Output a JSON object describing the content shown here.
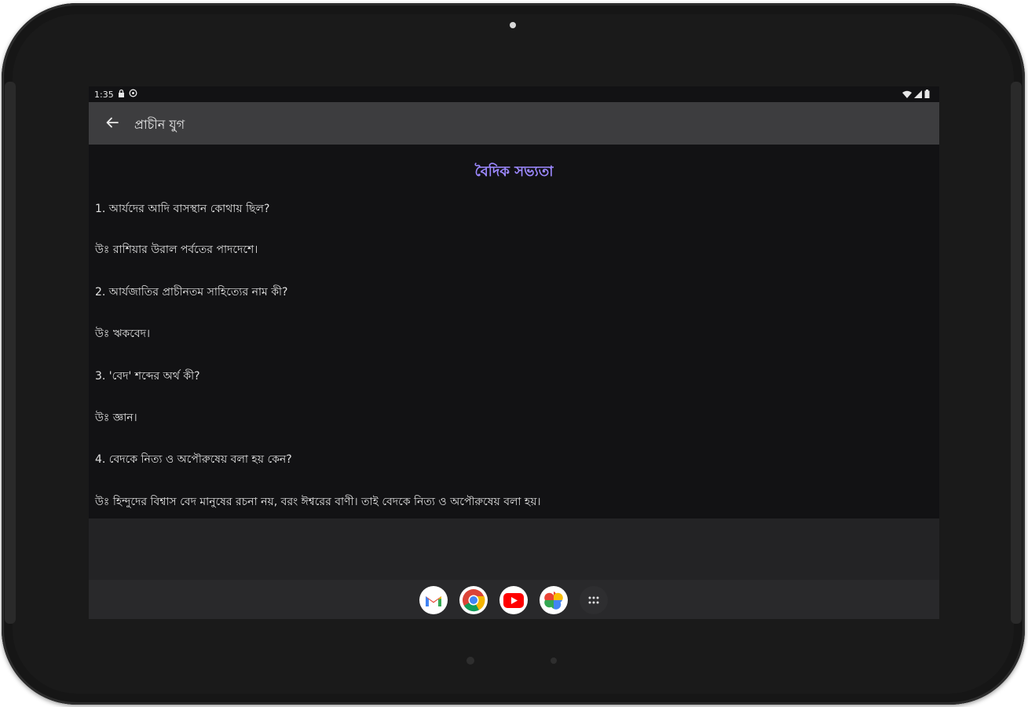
{
  "status_bar": {
    "time": "1:35"
  },
  "app_bar": {
    "title": "প্রাচীন যুগ",
    "back_icon": "arrow-left-icon"
  },
  "content": {
    "section_title": "বৈদিক সভ্যতা",
    "lines": [
      "1. আর্যদের আদি বাসস্থান কোথায় ছিল?",
      "উঃ রাশিয়ার উরাল পর্বতের পাদদেশে।",
      "2. আর্যজাতির প্রাচীনতম সাহিত্যের নাম কী?",
      "উঃ ঋকবেদ।",
      "3. 'বেদ' শব্দের অর্থ কী?",
      "উঃ জ্ঞান।",
      "4. বেদকে নিত্য ও অপৌরুষেয় বলা হয় কেন?",
      "উঃ হিন্দুদের বিশ্বাস বেদ মানুষের রচনা নয়, বরং ঈশ্বরের বাণী। তাই বেদকে নিত্য ও অপৌরুষেয় বলা হয়।"
    ]
  },
  "dock": {
    "apps": [
      "gmail-icon",
      "chrome-icon",
      "youtube-icon",
      "photos-icon",
      "app-drawer-icon"
    ]
  },
  "colors": {
    "accent": "#9c88ff",
    "app_bar": "#3d3d3f",
    "background": "#121214"
  }
}
